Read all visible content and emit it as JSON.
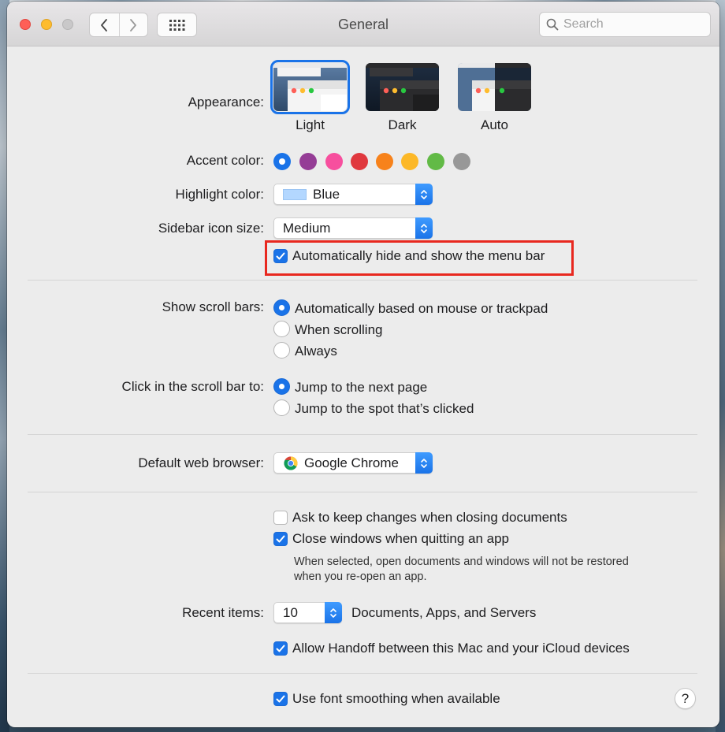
{
  "window": {
    "title": "General",
    "search_placeholder": "Search"
  },
  "appearance": {
    "label": "Appearance:",
    "options": [
      "Light",
      "Dark",
      "Auto"
    ],
    "selected": "Light"
  },
  "accent": {
    "label": "Accent color:",
    "colors": [
      "#1a73e8",
      "#953d96",
      "#f74f9e",
      "#e0383e",
      "#f7821b",
      "#fcb827",
      "#62ba46",
      "#989898"
    ],
    "selected_index": 0
  },
  "highlight": {
    "label": "Highlight color:",
    "value": "Blue",
    "swatch_color": "#b3d7ff"
  },
  "sidebar_icon": {
    "label": "Sidebar icon size:",
    "value": "Medium"
  },
  "menu_bar": {
    "label": "Automatically hide and show the menu bar",
    "checked": true
  },
  "scroll_bars": {
    "label": "Show scroll bars:",
    "options": [
      "Automatically based on mouse or trackpad",
      "When scrolling",
      "Always"
    ],
    "selected_index": 0
  },
  "click_scroll": {
    "label": "Click in the scroll bar to:",
    "options": [
      "Jump to the next page",
      "Jump to the spot that’s clicked"
    ],
    "selected_index": 0
  },
  "browser": {
    "label": "Default web browser:",
    "value": "Google Chrome"
  },
  "documents": {
    "ask_keep": {
      "label": "Ask to keep changes when closing documents",
      "checked": false
    },
    "close_windows": {
      "label": "Close windows when quitting an app",
      "checked": true
    },
    "note_line1": "When selected, open documents and windows will not be restored",
    "note_line2": "when you re-open an app."
  },
  "recent": {
    "label": "Recent items:",
    "value": "10",
    "suffix": "Documents, Apps, and Servers"
  },
  "handoff": {
    "label": "Allow Handoff between this Mac and your iCloud devices",
    "checked": true
  },
  "font_smoothing": {
    "label": "Use font smoothing when available",
    "checked": true
  },
  "help": {
    "label": "?"
  },
  "colors": {
    "accent": "#1a73e8",
    "highlight_border": "#e8281f"
  }
}
